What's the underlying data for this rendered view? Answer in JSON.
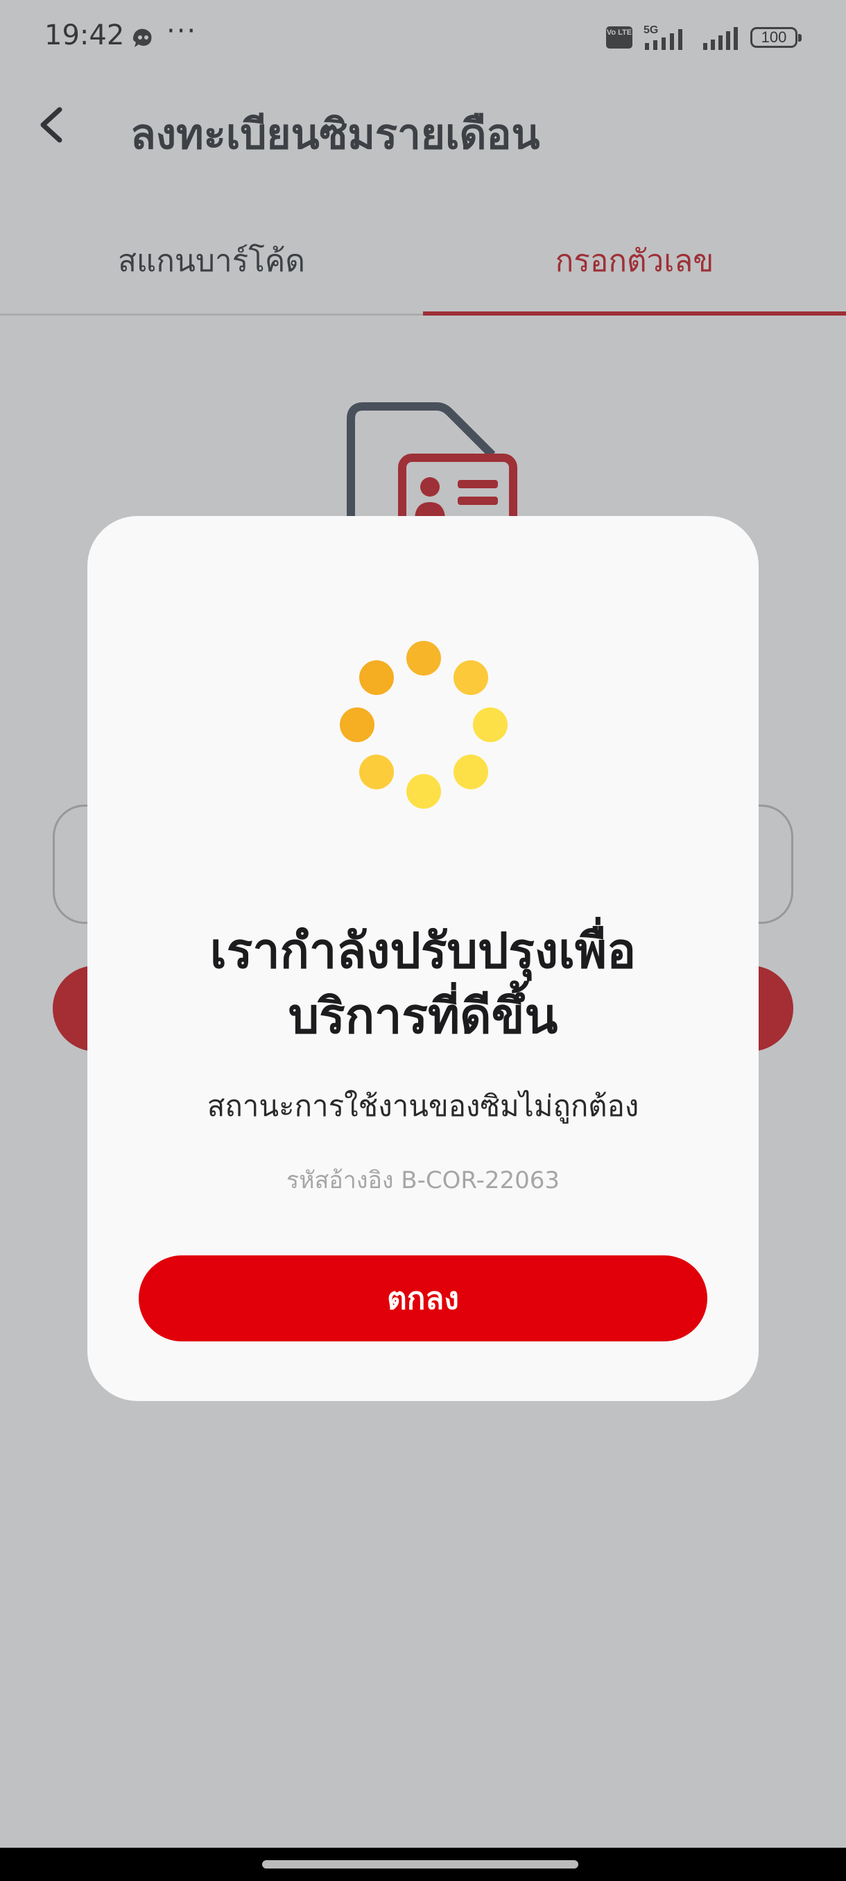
{
  "status_bar": {
    "time": "19:42",
    "more": "···",
    "network": "5G",
    "volte": "Vo LTE",
    "battery": "100"
  },
  "header": {
    "title": "ลงทะเบียนซิมรายเดือน"
  },
  "tabs": [
    {
      "label": "สแกนบาร์โค้ด",
      "active": false
    },
    {
      "label": "กรอกตัวเลข",
      "active": true
    }
  ],
  "dialog": {
    "title_line1": "เรากำลังปรับปรุงเพื่อ",
    "title_line2": "บริการที่ดีขึ้น",
    "message": "สถานะการใช้งานของซิมไม่ถูกต้อง",
    "reference": "รหัสอ้างอิง B-COR-22063",
    "ok_label": "ตกลง"
  },
  "colors": {
    "accent": "#c8161d",
    "button": "#e10009",
    "spinner_dark": "#f5ad22",
    "spinner_light": "#fde047"
  }
}
